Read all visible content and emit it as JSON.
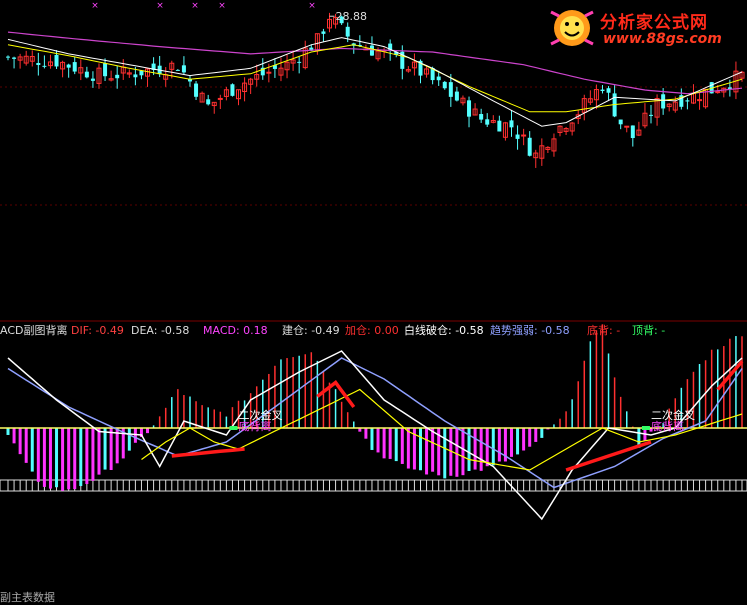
{
  "logo": {
    "title": "分析家公式网",
    "url": "www.88gs.com"
  },
  "price_label": "28.88",
  "legend": {
    "indicator_name": "ACD副图背离",
    "dif": "DIF: -0.49",
    "dea": "DEA: -0.58",
    "macd": "MACD: 0.18",
    "jian_cang": "建仓: -0.49",
    "jia_cang": "加仓: 0.00",
    "bai_xian_po_cang": "白线破仓: -0.58",
    "qu_shi_qiang_ruo": "趋势强弱: -0.58",
    "di_bei": "底背: -",
    "ding_bei": "顶背: -"
  },
  "annotations": {
    "cross_label": "二次金叉",
    "divergence_label": "底背离"
  },
  "bottom_text": "副主表数据",
  "colors": {
    "background": "#000000",
    "up_candle": "#ff3030",
    "down_candle": "#54ffff",
    "ma_white": "#ffffff",
    "ma_yellow": "#ffff00",
    "ma_purple": "#cc44cc",
    "dif_line": "#ffffff",
    "dea_line": "#8fa0ff",
    "macd_pos": "#ff3030",
    "macd_neg": "#ff33ff",
    "zero_line": "#ffff66",
    "strength_line": "#ffff00",
    "red_thick": "#ff1a1a"
  },
  "chart_data": [
    {
      "type": "candlestick",
      "title": "",
      "annotations": [
        "28.88"
      ],
      "n_bars": 122,
      "ylim": [
        19.0,
        29.5
      ],
      "close_path": [
        [
          0,
          26.6
        ],
        [
          8,
          26.4
        ],
        [
          15,
          25.6
        ],
        [
          20,
          25.7
        ],
        [
          28,
          26.2
        ],
        [
          33,
          23.9
        ],
        [
          38,
          25.1
        ],
        [
          46,
          26.2
        ],
        [
          51,
          27.5
        ],
        [
          53,
          28.88
        ],
        [
          57,
          27.4
        ],
        [
          62,
          26.8
        ],
        [
          68,
          25.8
        ],
        [
          72,
          24.8
        ],
        [
          78,
          23.2
        ],
        [
          83,
          22.8
        ],
        [
          87,
          21.2
        ],
        [
          90,
          22.5
        ],
        [
          94,
          23.6
        ],
        [
          98,
          25.1
        ],
        [
          101,
          23.0
        ],
        [
          103,
          22.2
        ],
        [
          107,
          24.0
        ],
        [
          112,
          24.4
        ],
        [
          116,
          24.8
        ],
        [
          121,
          25.6
        ]
      ],
      "ma_white_path": [
        [
          0,
          27.6
        ],
        [
          10,
          26.8
        ],
        [
          20,
          26.2
        ],
        [
          30,
          25.6
        ],
        [
          40,
          26.0
        ],
        [
          50,
          27.3
        ],
        [
          55,
          27.7
        ],
        [
          62,
          27.2
        ],
        [
          70,
          26.0
        ],
        [
          80,
          24.2
        ],
        [
          88,
          22.8
        ],
        [
          92,
          23.0
        ],
        [
          100,
          24.4
        ],
        [
          110,
          24.2
        ],
        [
          121,
          25.8
        ]
      ],
      "ma_yellow_path": [
        [
          0,
          27.3
        ],
        [
          10,
          26.7
        ],
        [
          20,
          26.0
        ],
        [
          30,
          25.4
        ],
        [
          40,
          25.7
        ],
        [
          50,
          26.9
        ],
        [
          57,
          27.3
        ],
        [
          66,
          26.6
        ],
        [
          76,
          25.0
        ],
        [
          86,
          23.6
        ],
        [
          92,
          23.6
        ],
        [
          100,
          24.0
        ],
        [
          110,
          24.3
        ],
        [
          121,
          25.4
        ]
      ],
      "ma_purple_path": [
        [
          0,
          28.0
        ],
        [
          12,
          27.6
        ],
        [
          25,
          27.2
        ],
        [
          40,
          26.8
        ],
        [
          55,
          27.1
        ],
        [
          70,
          26.9
        ],
        [
          85,
          26.2
        ],
        [
          95,
          25.4
        ],
        [
          105,
          24.8
        ],
        [
          112,
          24.6
        ],
        [
          121,
          24.9
        ]
      ]
    },
    {
      "type": "macd",
      "title": "ACD副图背离",
      "series": [
        {
          "name": "DIF",
          "values_path": [
            [
              0,
              1.0
            ],
            [
              8,
              0.4
            ],
            [
              15,
              -0.05
            ],
            [
              22,
              -0.1
            ],
            [
              25,
              -0.55
            ],
            [
              29,
              0.1
            ],
            [
              36,
              -0.1
            ],
            [
              40,
              0.4
            ],
            [
              48,
              0.8
            ],
            [
              55,
              1.1
            ],
            [
              62,
              0.4
            ],
            [
              70,
              -0.05
            ],
            [
              80,
              -0.55
            ],
            [
              88,
              -1.3
            ],
            [
              93,
              -0.6
            ],
            [
              99,
              0.0
            ],
            [
              106,
              -0.1
            ],
            [
              110,
              0.0
            ],
            [
              116,
              0.6
            ],
            [
              121,
              1.0
            ]
          ]
        },
        {
          "name": "DEA",
          "values_path": [
            [
              0,
              0.85
            ],
            [
              10,
              0.3
            ],
            [
              20,
              -0.1
            ],
            [
              28,
              -0.4
            ],
            [
              36,
              -0.2
            ],
            [
              44,
              0.3
            ],
            [
              55,
              1.0
            ],
            [
              62,
              0.7
            ],
            [
              72,
              0.1
            ],
            [
              82,
              -0.4
            ],
            [
              90,
              -0.85
            ],
            [
              100,
              -0.55
            ],
            [
              108,
              -0.15
            ],
            [
              115,
              0.1
            ],
            [
              121,
              0.85
            ]
          ]
        }
      ],
      "macd_hist_path": [
        [
          0,
          -0.1
        ],
        [
          5,
          -0.8
        ],
        [
          10,
          -0.9
        ],
        [
          15,
          -0.7
        ],
        [
          20,
          -0.35
        ],
        [
          25,
          0.15
        ],
        [
          28,
          0.55
        ],
        [
          32,
          0.3
        ],
        [
          36,
          0.2
        ],
        [
          40,
          0.5
        ],
        [
          45,
          1.0
        ],
        [
          50,
          1.1
        ],
        [
          55,
          0.4
        ],
        [
          60,
          -0.3
        ],
        [
          65,
          -0.55
        ],
        [
          72,
          -0.7
        ],
        [
          80,
          -0.55
        ],
        [
          86,
          -0.3
        ],
        [
          92,
          0.2
        ],
        [
          96,
          1.2
        ],
        [
          98,
          1.5
        ],
        [
          100,
          0.7
        ],
        [
          104,
          -0.25
        ],
        [
          108,
          0.1
        ],
        [
          112,
          0.7
        ],
        [
          116,
          1.1
        ],
        [
          121,
          1.35
        ]
      ],
      "ylim": [
        -1.6,
        1.6
      ]
    }
  ]
}
